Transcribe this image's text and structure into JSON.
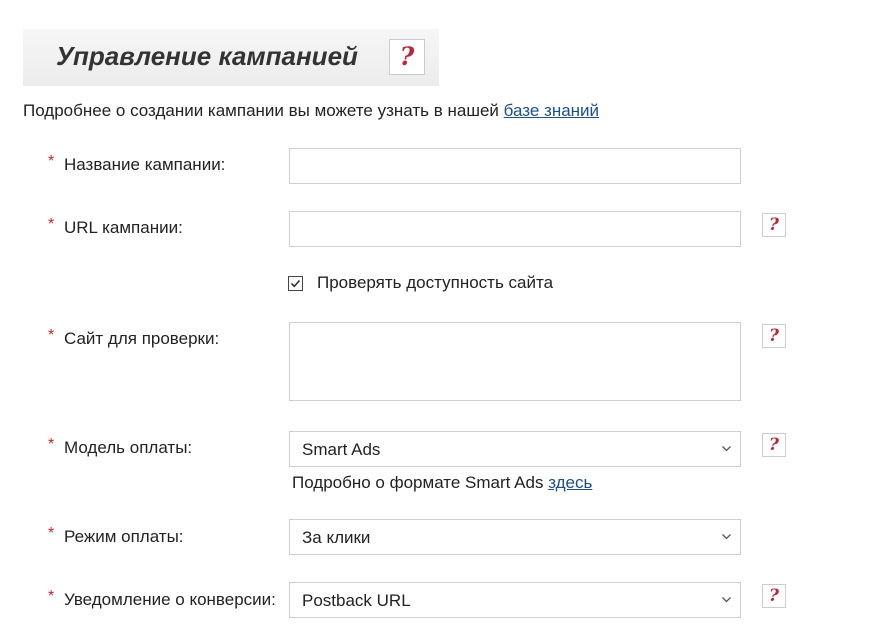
{
  "header": {
    "title": "Управление кампанией",
    "help_glyph": "?"
  },
  "intro": {
    "text": "Подробнее о создании кампании вы можете узнать в нашей ",
    "link_label": "базе знаний"
  },
  "fields": {
    "required_mark": "*",
    "campaign_name": {
      "label": "Название кампании:",
      "value": ""
    },
    "campaign_url": {
      "label": "URL кампании:",
      "value": ""
    },
    "check_availability": {
      "label": "Проверять доступность сайта",
      "checked": true
    },
    "check_site": {
      "label": "Сайт для проверки:",
      "value": ""
    },
    "payment_model": {
      "label": "Модель оплаты:",
      "selected": "Smart Ads",
      "hint_text": "Подробно о формате Smart Ads ",
      "hint_link": "здесь"
    },
    "payment_mode": {
      "label": "Режим оплаты:",
      "selected": "За клики"
    },
    "conversion_notice": {
      "label": "Уведомление о конверсии:",
      "selected": "Postback URL"
    }
  },
  "icons": {
    "help": "question-mark-icon",
    "dropdown": "chevron-down-icon",
    "checkbox": "checkmark-icon"
  },
  "colors": {
    "required": "#c0272d",
    "help_mark": "#b8283b",
    "link": "#1a4f8a",
    "title_bg": "#efefef"
  }
}
